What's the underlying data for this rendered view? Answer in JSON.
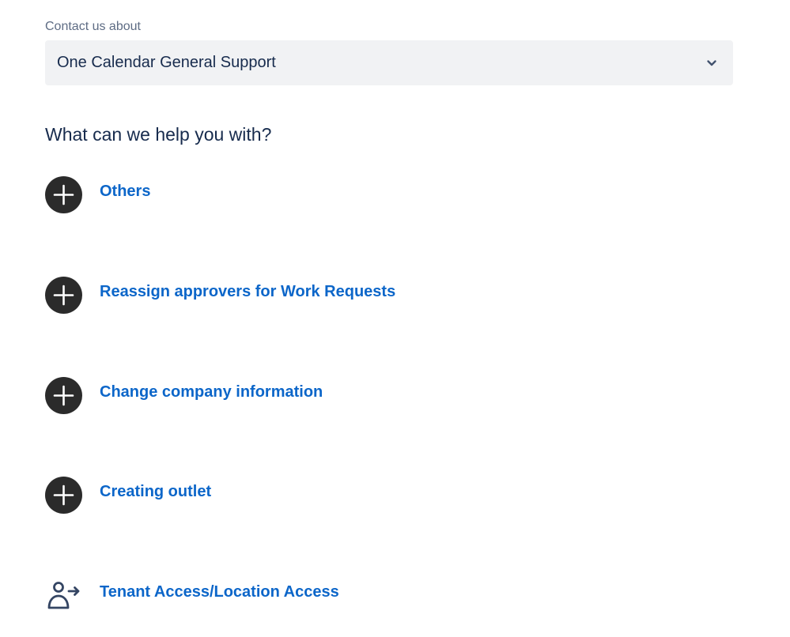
{
  "contact": {
    "label": "Contact us about",
    "selected": "One Calendar General Support"
  },
  "help": {
    "heading": "What can we help you with?"
  },
  "requests": [
    {
      "label": "Others",
      "icon": "plus-circle-icon"
    },
    {
      "label": "Reassign approvers for Work Requests",
      "icon": "plus-circle-icon"
    },
    {
      "label": "Change company information",
      "icon": "plus-circle-icon"
    },
    {
      "label": "Creating outlet",
      "icon": "plus-circle-icon"
    },
    {
      "label": "Tenant Access/Location Access",
      "icon": "user-arrow-icon"
    }
  ],
  "colors": {
    "link": "#0c66c9",
    "icon_fill": "#2b2b2b",
    "select_bg": "#f1f2f4",
    "heading": "#172b4d"
  }
}
